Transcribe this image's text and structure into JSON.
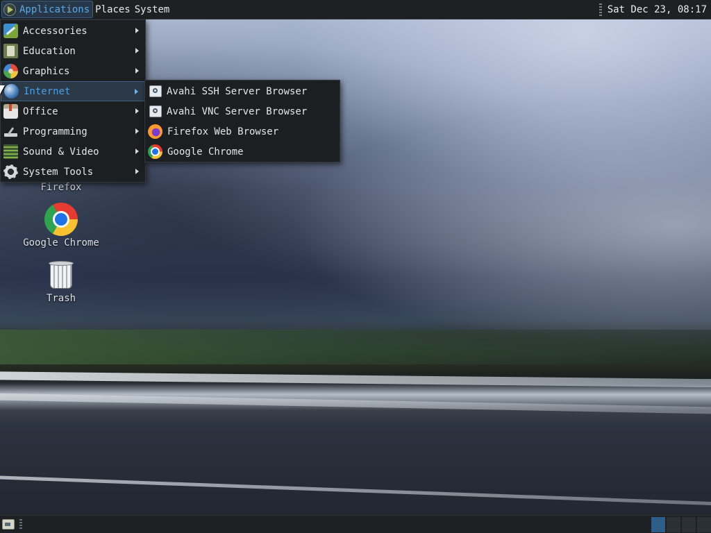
{
  "top_panel": {
    "applications_label": "Applications",
    "places_label": "Places",
    "system_label": "System",
    "clock": "Sat Dec 23, 08:17"
  },
  "desktop": {
    "icons": [
      {
        "label": "Firefox",
        "icon": "firefox-icon"
      },
      {
        "label": "Google Chrome",
        "icon": "chrome-icon"
      },
      {
        "label": "Trash",
        "icon": "trash-icon"
      }
    ]
  },
  "applications_menu": {
    "items": [
      {
        "label": "Accessories",
        "icon": "accessories-icon"
      },
      {
        "label": "Education",
        "icon": "education-icon"
      },
      {
        "label": "Graphics",
        "icon": "graphics-icon"
      },
      {
        "label": "Internet",
        "icon": "internet-icon",
        "active": true
      },
      {
        "label": "Office",
        "icon": "office-icon"
      },
      {
        "label": "Programming",
        "icon": "programming-icon"
      },
      {
        "label": "Sound & Video",
        "icon": "sound-video-icon"
      },
      {
        "label": "System Tools",
        "icon": "system-tools-icon"
      }
    ]
  },
  "internet_submenu": {
    "items": [
      {
        "label": "Avahi SSH Server Browser",
        "icon": "avahi-icon"
      },
      {
        "label": "Avahi VNC Server Browser",
        "icon": "avahi-icon"
      },
      {
        "label": "Firefox Web Browser",
        "icon": "firefox-icon"
      },
      {
        "label": "Google Chrome",
        "icon": "chrome-icon"
      }
    ]
  },
  "colors": {
    "panel_bg": "#1e2124",
    "menu_bg": "#1c1f22",
    "accent": "#4e9ee0",
    "active_item_bg": "#2c3a48"
  }
}
